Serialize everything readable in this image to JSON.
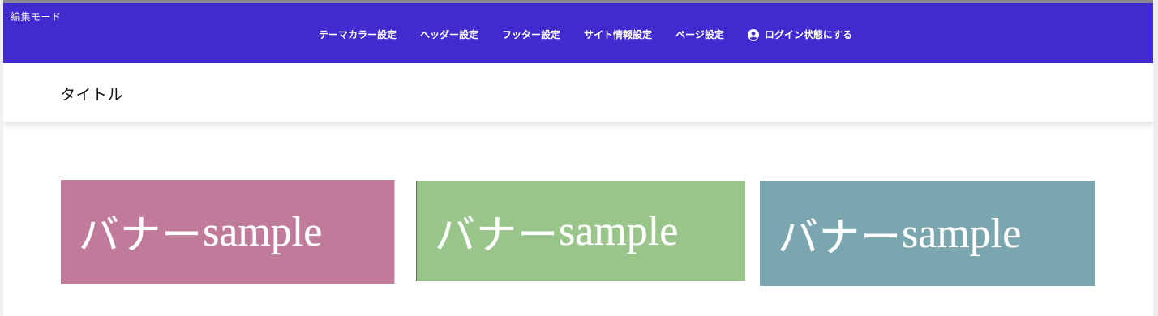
{
  "edit_bar": {
    "label": "編集モード",
    "menu": [
      {
        "label": "テーマカラー設定"
      },
      {
        "label": "ヘッダー設定"
      },
      {
        "label": "フッター設定"
      },
      {
        "label": "サイト情報設定"
      },
      {
        "label": "ページ設定"
      },
      {
        "label": "ログイン状態にする",
        "icon": "user-circle-icon"
      }
    ],
    "background_color": "#402bcf"
  },
  "header": {
    "title": "タイトル"
  },
  "banners": [
    {
      "text_ja": "バナー",
      "text_en": "sample",
      "color": "#c07b9b"
    },
    {
      "text_ja": "バナー",
      "text_en": "sample",
      "color": "#99c58b"
    },
    {
      "text_ja": "バナー",
      "text_en": "sample",
      "color": "#7aa6af"
    }
  ]
}
